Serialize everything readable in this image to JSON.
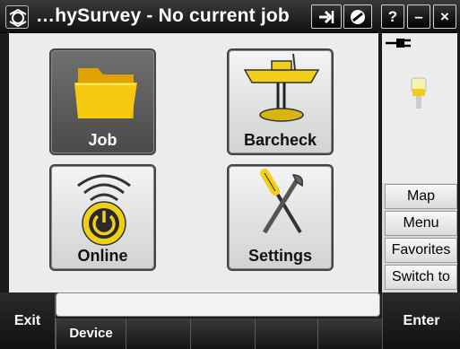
{
  "titlebar": {
    "app_icon": "trimble-logo-icon",
    "title": "…hySurvey - No current job",
    "btn_logout_icon": "login-arrow-icon",
    "btn_stop_icon": "no-entry-icon",
    "btn_help": "?",
    "btn_minimize": "–",
    "btn_close": "×"
  },
  "tiles": [
    {
      "label": "Job",
      "icon": "folder-icon",
      "active": true
    },
    {
      "label": "Barcheck",
      "icon": "boat-barcheck-icon",
      "active": false
    },
    {
      "label": "Online",
      "icon": "wireless-power-icon",
      "active": false
    },
    {
      "label": "Settings",
      "icon": "screwdriver-wrench-icon",
      "active": false
    }
  ],
  "status": {
    "power_icon": "power-plug-icon",
    "receiver_icon": "gnss-receiver-icon"
  },
  "side_menu": {
    "map": "Map",
    "menu": "Menu",
    "favorites": "Favorites",
    "switch_to": "Switch to"
  },
  "bottom": {
    "exit": "Exit",
    "enter": "Enter",
    "softkeys": [
      "Device",
      "",
      "",
      "",
      ""
    ],
    "input_value": ""
  },
  "colors": {
    "accent_yellow": "#f2cf17",
    "active_tile": "#5a5a5a",
    "bar_dark": "#1a1a1a"
  }
}
